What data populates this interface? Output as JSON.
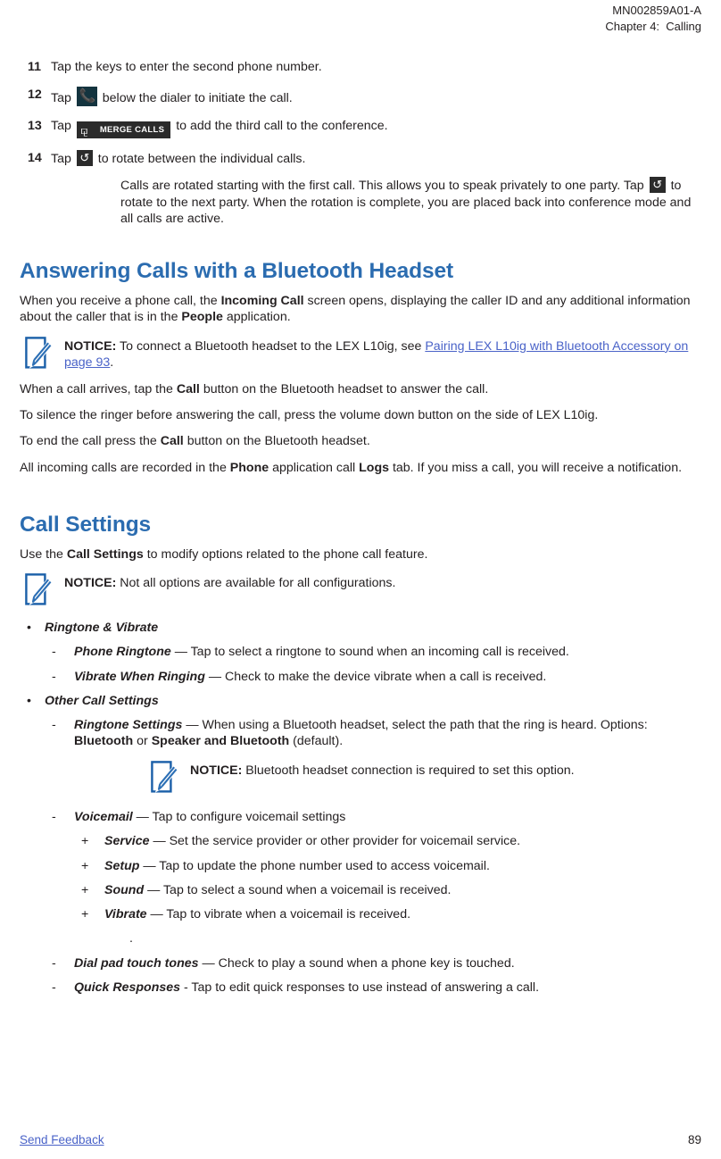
{
  "runhead": {
    "doc_id": "MN002859A01-A",
    "chapter": "Chapter 4:  Calling"
  },
  "steps": [
    {
      "num": "11",
      "text_before": "Tap the keys to enter the second phone number.",
      "icon": "",
      "text_after": ""
    },
    {
      "num": "12",
      "text_before": "Tap ",
      "icon": "phone-handset-icon",
      "text_after": " below the dialer to initiate the call."
    },
    {
      "num": "13",
      "text_before": "Tap ",
      "icon": "merge-calls-button-icon",
      "icon_label": "MERGE CALLS",
      "text_after": " to add the third call to the conference."
    },
    {
      "num": "14",
      "text_before": "Tap ",
      "icon": "rotate-calls-icon",
      "text_after": " to rotate between the individual calls."
    }
  ],
  "step14_continuation": {
    "part1": "Calls are rotated starting with the first call. This allows you to speak privately to one party. Tap ",
    "icon": "rotate-calls-icon",
    "part2": " to rotate to the next party. When the rotation is complete, you are placed back into conference mode and all calls are active."
  },
  "section_bluetooth": {
    "heading": "Answering Calls with a Bluetooth Headset",
    "intro": {
      "p1_a": "When you receive a phone call, the ",
      "p1_b": "Incoming Call",
      "p1_c": " screen opens, displaying the caller ID and any additional information about the caller that is in the ",
      "p1_d": "People",
      "p1_e": " application."
    },
    "notice": {
      "label": "NOTICE:",
      "text_a": " To connect a Bluetooth headset to the LEX L10ig, see ",
      "link": "Pairing LEX L10ig with Bluetooth Accessory on page 93",
      "text_b": "."
    },
    "p2_a": "When a call arrives, tap the ",
    "p2_b": "Call",
    "p2_c": " button on the Bluetooth headset to answer the call.",
    "p3": "To silence the ringer before answering the call, press the volume down button on the side of LEX L10ig.",
    "p4_a": "To end the call press the ",
    "p4_b": "Call",
    "p4_c": " button on the Bluetooth headset.",
    "p5_a": "All incoming calls are recorded in the ",
    "p5_b": "Phone",
    "p5_c": " application call ",
    "p5_d": "Logs",
    "p5_e": " tab. If you miss a call, you will receive a notification."
  },
  "section_call_settings": {
    "heading": "Call Settings",
    "intro_a": "Use the ",
    "intro_b": "Call Settings",
    "intro_c": " to modify options related to the phone call feature.",
    "notice": {
      "label": "NOTICE:",
      "text": " Not all options are available for all configurations."
    },
    "groups": [
      {
        "marker": "•",
        "title": "Ringtone & Vibrate",
        "items": [
          {
            "marker": "-",
            "term": "Phone Ringtone",
            "desc": " — Tap to select a ringtone to sound when an incoming call is received."
          },
          {
            "marker": "-",
            "term": "Vibrate When Ringing",
            "desc": " — Check to make the device vibrate when a call is received."
          }
        ]
      },
      {
        "marker": "•",
        "title": "Other Call Settings",
        "items": [
          {
            "marker": "-",
            "term": "Ringtone Settings",
            "desc_a": " — When using a Bluetooth headset, select the path that the ring is heard. Options: ",
            "opt1": "Bluetooth",
            "desc_b": " or ",
            "opt2": "Speaker and Bluetooth",
            "desc_c": " (default).",
            "notice": {
              "label": "NOTICE:",
              "text": " Bluetooth headset connection is required to set this option."
            }
          },
          {
            "marker": "-",
            "term": "Voicemail",
            "desc": " — Tap to configure voicemail settings",
            "subitems": [
              {
                "marker": "+",
                "term": "Service",
                "desc": " — Set the service provider or other provider for voicemail service."
              },
              {
                "marker": "+",
                "term": "Setup",
                "desc": " — Tap to update the phone number used to access voicemail."
              },
              {
                "marker": "+",
                "term": "Sound",
                "desc": " — Tap to select a sound when a voicemail is received."
              },
              {
                "marker": "+",
                "term": "Vibrate",
                "desc": " — Tap to vibrate when a voicemail is received."
              }
            ],
            "trailing_dot": "."
          },
          {
            "marker": "-",
            "term": "Dial pad touch tones",
            "desc": " — Check to play a sound when a phone key is touched."
          },
          {
            "marker": "-",
            "term": "Quick Responses",
            "desc": " - Tap to edit quick responses to use instead of answering a call."
          }
        ]
      }
    ]
  },
  "footer": {
    "feedback": "Send Feedback",
    "page_number": "89"
  },
  "colors": {
    "heading_blue": "#2b6cb0",
    "link_blue": "#4a63c8",
    "notice_icon_blue": "#1a5fa8",
    "body_text": "#231f20",
    "phone_chip_bg": "#14343f",
    "dark_chip_bg": "#2b2b2b"
  }
}
